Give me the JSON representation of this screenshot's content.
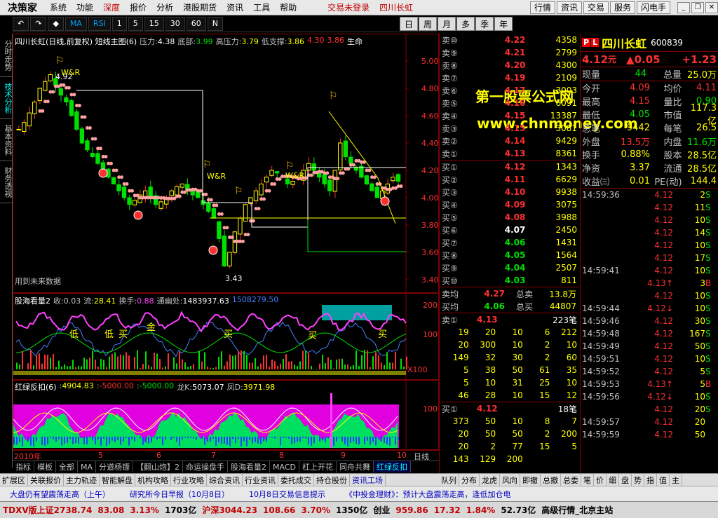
{
  "menu": {
    "logo": "决策家",
    "items": [
      "系统",
      "功能",
      "深度",
      "报价",
      "分析",
      "港股期货",
      "资讯",
      "工具",
      "帮助"
    ],
    "highlight": "深度",
    "trade": "交易未登录",
    "stock_link": "四川长虹",
    "right_buttons": [
      "行情",
      "资讯",
      "交易",
      "服务",
      "闪电手"
    ]
  },
  "toolbar": {
    "buttons": [
      "MA",
      "RSI",
      "1",
      "5",
      "15",
      "30",
      "60",
      "N"
    ],
    "periods": [
      "日",
      "周",
      "月",
      "多",
      "季",
      "年"
    ]
  },
  "left_tabs": [
    "分时走势",
    "技术分析",
    "基本资料",
    "财务透视"
  ],
  "main_chart": {
    "title": "四川长虹(日线,前复权) 短线主图(6)",
    "legend": [
      {
        "label": "压力:",
        "value": "4.38",
        "color": "#fff"
      },
      {
        "label": "底部:",
        "value": "3.99",
        "color": "#00e000"
      },
      {
        "label": "高压力:",
        "value": "3.79",
        "color": "#ffff00"
      },
      {
        "label": "低支撑:",
        "value": "3.86",
        "color": "#ffff00"
      },
      {
        "label": "",
        "value": "4.30",
        "color": "#ff3030"
      },
      {
        "label": "",
        "value": "3.86",
        "color": "#ff3030"
      },
      {
        "label": "",
        "value": "生命",
        "color": "#fff"
      }
    ],
    "y_labels": [
      "5.00",
      "4.80",
      "4.60",
      "4.40",
      "4.20",
      "4.00",
      "3.80",
      "3.60",
      "3.40"
    ],
    "annotations": {
      "high": "4.92",
      "low": "3.43",
      "war1": "W&R",
      "war2": "W&R",
      "war3": "W&R",
      "future": "用到未来数据"
    },
    "watermark1": "第一股票公式网",
    "watermark2": "www.chnmoney.com"
  },
  "ind1": {
    "title": "股海看量2",
    "legend": [
      {
        "label": "收:",
        "value": "0.03",
        "color": "#c0c0c0"
      },
      {
        "label": "流:",
        "value": "28.41",
        "color": "#ffff00"
      },
      {
        "label": "换手:",
        "value": "0.88",
        "color": "#ff40ff"
      },
      {
        "label": "通幽处:",
        "value": "1483937.63",
        "color": "#fff"
      },
      {
        "label": "",
        "value": "1508279.50",
        "color": "#4080ff"
      }
    ],
    "y_labels": [
      "20000",
      "10000"
    ],
    "unit": "X100",
    "txt": [
      "低",
      "低",
      "买",
      "金",
      "买",
      "买",
      "买"
    ]
  },
  "ind2": {
    "title": "红绿反扣(6)",
    "legend": [
      {
        "label": ":",
        "value": "4904.83",
        "color": "#ffff00"
      },
      {
        "label": ":",
        "value": "-5000.00",
        "color": "#ff3030"
      },
      {
        "label": ":",
        "value": "-5000.00",
        "color": "#00e000"
      },
      {
        "label": "龙K:",
        "value": "5073.07",
        "color": "#fff"
      },
      {
        "label": "凤D:",
        "value": "3971.98",
        "color": "#ffff00"
      }
    ],
    "y_labels": [
      "10000"
    ]
  },
  "x_axis": {
    "labels": [
      "2010年",
      "5",
      "6",
      "7",
      "8",
      "9",
      "10"
    ],
    "suffix": "日线"
  },
  "bottom_tabs": [
    "指标",
    "模板",
    "全部",
    "MA",
    "分道杨镖",
    "【翻山炮】2",
    "命运操盘手",
    "股海看量2",
    "MACD",
    "杠上开花",
    "同舟共舞",
    "红绿反扣"
  ],
  "quote": {
    "sells": [
      {
        "n": "卖⑩",
        "p": "4.22",
        "v": "4358",
        "c": "#ff3030"
      },
      {
        "n": "卖⑨",
        "p": "4.21",
        "v": "2799",
        "c": "#ff3030"
      },
      {
        "n": "卖⑧",
        "p": "4.20",
        "v": "4300",
        "c": "#ff3030"
      },
      {
        "n": "卖⑦",
        "p": "4.19",
        "v": "2109",
        "c": "#ff3030"
      },
      {
        "n": "卖⑥",
        "p": "4.17",
        "v": "3003",
        "c": "#ff3030"
      },
      {
        "n": "卖⑤",
        "p": "4.16",
        "v": "6091",
        "c": "#ff3030"
      },
      {
        "n": "卖④",
        "p": "4.15",
        "v": "13387",
        "c": "#ff3030"
      },
      {
        "n": "卖③",
        "p": "4.15",
        "v": "3081",
        "c": "#ff3030"
      },
      {
        "n": "卖②",
        "p": "4.14",
        "v": "9429",
        "c": "#ff3030"
      },
      {
        "n": "卖①",
        "p": "4.13",
        "v": "8361",
        "c": "#ff3030"
      }
    ],
    "buys": [
      {
        "n": "买①",
        "p": "4.12",
        "v": "1343",
        "c": "#ff3030"
      },
      {
        "n": "买②",
        "p": "4.11",
        "v": "6629",
        "c": "#ff3030"
      },
      {
        "n": "买③",
        "p": "4.10",
        "v": "9938",
        "c": "#ff3030"
      },
      {
        "n": "买④",
        "p": "4.09",
        "v": "3075",
        "c": "#ff3030"
      },
      {
        "n": "买⑤",
        "p": "4.08",
        "v": "3988",
        "c": "#ff3030"
      },
      {
        "n": "买⑥",
        "p": "4.07",
        "v": "2450",
        "c": "#ffffff"
      },
      {
        "n": "买⑦",
        "p": "4.06",
        "v": "1431",
        "c": "#00e000"
      },
      {
        "n": "买⑧",
        "p": "4.05",
        "v": "1564",
        "c": "#00e000"
      },
      {
        "n": "买⑨",
        "p": "4.04",
        "v": "2507",
        "c": "#00e000"
      },
      {
        "n": "买⑩",
        "p": "4.03",
        "v": "811",
        "c": "#00e000"
      }
    ],
    "avg_sell": {
      "n": "卖均",
      "p": "4.27",
      "l": "总卖",
      "v": "13.8万"
    },
    "avg_buy": {
      "n": "买均",
      "p": "4.06",
      "l": "总买",
      "v": "44807"
    },
    "sell1": {
      "n": "卖①",
      "p": "4.13",
      "v": "223笔"
    },
    "sell_grid": [
      [
        "19",
        "20",
        "10",
        "6",
        "212"
      ],
      [
        "20",
        "300",
        "10",
        "2",
        "10"
      ],
      [
        "149",
        "32",
        "30",
        "2",
        "60"
      ],
      [
        "5",
        "38",
        "50",
        "61",
        "35"
      ],
      [
        "5",
        "10",
        "31",
        "25",
        "10"
      ],
      [
        "46",
        "28",
        "10",
        "15",
        "12"
      ]
    ],
    "buy1": {
      "n": "买①",
      "p": "4.12",
      "v": "18笔"
    },
    "buy_grid": [
      [
        "373",
        "50",
        "10",
        "8",
        "7"
      ],
      [
        "20",
        "50",
        "50",
        "2",
        "200"
      ],
      [
        "20",
        "2",
        "77",
        "15",
        "5"
      ],
      [
        "143",
        "129",
        "200",
        "",
        ""
      ]
    ]
  },
  "info": {
    "code": "600839",
    "name": "四川长虹",
    "price": "4.12",
    "unit": "元",
    "chg": "▲0.05",
    "pct": "+1.23",
    "xianliang": {
      "l": "现量",
      "v": "44",
      "l2": "总量",
      "v2": "25.0万"
    },
    "rows": [
      [
        "今开",
        "4.09",
        "均价",
        "4.11"
      ],
      [
        "最高",
        "4.15",
        "量比",
        "0.90"
      ],
      [
        "最低",
        "4.05",
        "市值",
        "117.3亿"
      ],
      [
        "总笔",
        "9442",
        "每笔",
        "26.5"
      ],
      [
        "外盘",
        "13.5万",
        "内盘",
        "11.6万"
      ],
      [
        "换手",
        "0.88%",
        "股本",
        "28.5亿"
      ],
      [
        "净资",
        "3.37",
        "流通",
        "28.5亿"
      ],
      [
        "收益㈢",
        "0.01",
        "PE(动)",
        "144.4"
      ]
    ],
    "ticks": [
      [
        "14:59:36",
        "4.12",
        "2",
        "S"
      ],
      [
        "",
        "4.12",
        "11",
        "S"
      ],
      [
        "",
        "4.12",
        "10",
        "S"
      ],
      [
        "",
        "4.12",
        "14",
        "S"
      ],
      [
        "",
        "4.12",
        "10",
        "S"
      ],
      [
        "",
        "4.12",
        "17",
        "S"
      ],
      [
        "14:59:41",
        "4.12",
        "10",
        "S"
      ],
      [
        "",
        "4.13↑",
        "3",
        "B"
      ],
      [
        "",
        "4.12",
        "10",
        "S"
      ],
      [
        "14:59:44",
        "4.12↓",
        "10",
        "S"
      ],
      [
        "14:59:46",
        "4.12",
        "30",
        "S"
      ],
      [
        "14:59:48",
        "4.12",
        "167",
        "S"
      ],
      [
        "14:59:49",
        "4.12",
        "50",
        "S"
      ],
      [
        "14:59:51",
        "4.12",
        "10",
        "S"
      ],
      [
        "14:59:52",
        "4.12",
        "5",
        "S"
      ],
      [
        "14:59:53",
        "4.13↑",
        "5",
        "B"
      ],
      [
        "14:59:56",
        "4.12↓",
        "10",
        "S"
      ],
      [
        "",
        "4.12",
        "20",
        "S"
      ],
      [
        "14:59:57",
        "4.12",
        "20",
        ""
      ],
      [
        "14:59:59",
        "4.12",
        "50",
        ""
      ]
    ]
  },
  "func_left": [
    "扩展区",
    "关联报价",
    "主力轨迹",
    "智能解盘",
    "机构攻略",
    "行业攻略",
    "综合资讯",
    "行业资讯",
    "委托成交",
    "持仓股份",
    "资讯工场"
  ],
  "func_right": [
    "队列",
    "分布",
    "龙虎",
    "风向",
    "即撤",
    "总撤",
    "总委",
    "笔",
    "价",
    "细",
    "盘",
    "势",
    "指",
    "值",
    "主"
  ],
  "news": [
    "大盘仍有望震荡走高（上午）",
    "研究所今日早报（10月8日）",
    "10月8日交易信息提示",
    "《中投金理财》：预计大盘震荡走高，逢低加仓电"
  ],
  "status": [
    {
      "t": "TDXV版上证2738.74",
      "c": "#c00000"
    },
    {
      "t": "83.08",
      "c": "#c00000"
    },
    {
      "t": "3.13%",
      "c": "#c00000"
    },
    {
      "t": "1703亿",
      "c": "#000"
    },
    {
      "t": "沪深3044.23",
      "c": "#c00000"
    },
    {
      "t": "108.66",
      "c": "#c00000"
    },
    {
      "t": "3.70%",
      "c": "#c00000"
    },
    {
      "t": "1350亿",
      "c": "#000"
    },
    {
      "t": "创业",
      "c": "#000"
    },
    {
      "t": "959.86",
      "c": "#c00000"
    },
    {
      "t": "17.32",
      "c": "#c00000"
    },
    {
      "t": "1.84%",
      "c": "#c00000"
    },
    {
      "t": "52.73亿",
      "c": "#000"
    },
    {
      "t": "高级行情_北京主站",
      "c": "#000"
    }
  ]
}
